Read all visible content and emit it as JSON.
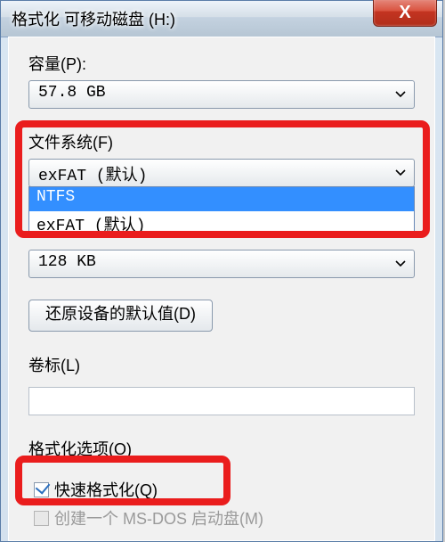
{
  "window": {
    "title": "格式化 可移动磁盘 (H:)",
    "close_glyph": "X"
  },
  "capacity": {
    "label": "容量(P):",
    "value": "57.8 GB"
  },
  "filesystem": {
    "label": "文件系统(F)",
    "value": "exFAT (默认)",
    "options": [
      "NTFS",
      "exFAT (默认)"
    ],
    "selected_option_index": 0
  },
  "alloc": {
    "value": "128 KB"
  },
  "restore_defaults": {
    "label": "还原设备的默认值(D)"
  },
  "volume_label": {
    "label": "卷标(L)",
    "value": ""
  },
  "format_options": {
    "label": "格式化选项(O)",
    "quick_format": {
      "label": "快速格式化(Q)",
      "checked": true
    },
    "msdos_boot": {
      "label": "创建一个 MS-DOS 启动盘(M)",
      "checked": false,
      "disabled": true
    }
  }
}
